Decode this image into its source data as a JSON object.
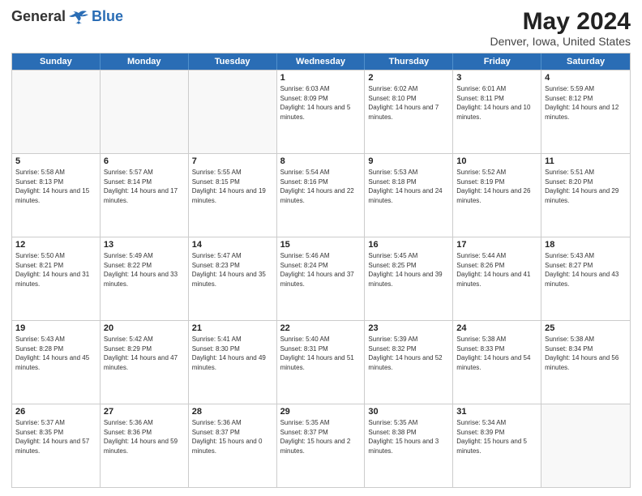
{
  "header": {
    "logo_line1": "General",
    "logo_line2": "Blue",
    "title": "May 2024",
    "subtitle": "Denver, Iowa, United States"
  },
  "weekdays": [
    "Sunday",
    "Monday",
    "Tuesday",
    "Wednesday",
    "Thursday",
    "Friday",
    "Saturday"
  ],
  "weeks": [
    [
      {
        "day": "",
        "empty": true
      },
      {
        "day": "",
        "empty": true
      },
      {
        "day": "",
        "empty": true
      },
      {
        "day": "1",
        "sunrise": "Sunrise: 6:03 AM",
        "sunset": "Sunset: 8:09 PM",
        "daylight": "Daylight: 14 hours and 5 minutes."
      },
      {
        "day": "2",
        "sunrise": "Sunrise: 6:02 AM",
        "sunset": "Sunset: 8:10 PM",
        "daylight": "Daylight: 14 hours and 7 minutes."
      },
      {
        "day": "3",
        "sunrise": "Sunrise: 6:01 AM",
        "sunset": "Sunset: 8:11 PM",
        "daylight": "Daylight: 14 hours and 10 minutes."
      },
      {
        "day": "4",
        "sunrise": "Sunrise: 5:59 AM",
        "sunset": "Sunset: 8:12 PM",
        "daylight": "Daylight: 14 hours and 12 minutes."
      }
    ],
    [
      {
        "day": "5",
        "sunrise": "Sunrise: 5:58 AM",
        "sunset": "Sunset: 8:13 PM",
        "daylight": "Daylight: 14 hours and 15 minutes."
      },
      {
        "day": "6",
        "sunrise": "Sunrise: 5:57 AM",
        "sunset": "Sunset: 8:14 PM",
        "daylight": "Daylight: 14 hours and 17 minutes."
      },
      {
        "day": "7",
        "sunrise": "Sunrise: 5:55 AM",
        "sunset": "Sunset: 8:15 PM",
        "daylight": "Daylight: 14 hours and 19 minutes."
      },
      {
        "day": "8",
        "sunrise": "Sunrise: 5:54 AM",
        "sunset": "Sunset: 8:16 PM",
        "daylight": "Daylight: 14 hours and 22 minutes."
      },
      {
        "day": "9",
        "sunrise": "Sunrise: 5:53 AM",
        "sunset": "Sunset: 8:18 PM",
        "daylight": "Daylight: 14 hours and 24 minutes."
      },
      {
        "day": "10",
        "sunrise": "Sunrise: 5:52 AM",
        "sunset": "Sunset: 8:19 PM",
        "daylight": "Daylight: 14 hours and 26 minutes."
      },
      {
        "day": "11",
        "sunrise": "Sunrise: 5:51 AM",
        "sunset": "Sunset: 8:20 PM",
        "daylight": "Daylight: 14 hours and 29 minutes."
      }
    ],
    [
      {
        "day": "12",
        "sunrise": "Sunrise: 5:50 AM",
        "sunset": "Sunset: 8:21 PM",
        "daylight": "Daylight: 14 hours and 31 minutes."
      },
      {
        "day": "13",
        "sunrise": "Sunrise: 5:49 AM",
        "sunset": "Sunset: 8:22 PM",
        "daylight": "Daylight: 14 hours and 33 minutes."
      },
      {
        "day": "14",
        "sunrise": "Sunrise: 5:47 AM",
        "sunset": "Sunset: 8:23 PM",
        "daylight": "Daylight: 14 hours and 35 minutes."
      },
      {
        "day": "15",
        "sunrise": "Sunrise: 5:46 AM",
        "sunset": "Sunset: 8:24 PM",
        "daylight": "Daylight: 14 hours and 37 minutes."
      },
      {
        "day": "16",
        "sunrise": "Sunrise: 5:45 AM",
        "sunset": "Sunset: 8:25 PM",
        "daylight": "Daylight: 14 hours and 39 minutes."
      },
      {
        "day": "17",
        "sunrise": "Sunrise: 5:44 AM",
        "sunset": "Sunset: 8:26 PM",
        "daylight": "Daylight: 14 hours and 41 minutes."
      },
      {
        "day": "18",
        "sunrise": "Sunrise: 5:43 AM",
        "sunset": "Sunset: 8:27 PM",
        "daylight": "Daylight: 14 hours and 43 minutes."
      }
    ],
    [
      {
        "day": "19",
        "sunrise": "Sunrise: 5:43 AM",
        "sunset": "Sunset: 8:28 PM",
        "daylight": "Daylight: 14 hours and 45 minutes."
      },
      {
        "day": "20",
        "sunrise": "Sunrise: 5:42 AM",
        "sunset": "Sunset: 8:29 PM",
        "daylight": "Daylight: 14 hours and 47 minutes."
      },
      {
        "day": "21",
        "sunrise": "Sunrise: 5:41 AM",
        "sunset": "Sunset: 8:30 PM",
        "daylight": "Daylight: 14 hours and 49 minutes."
      },
      {
        "day": "22",
        "sunrise": "Sunrise: 5:40 AM",
        "sunset": "Sunset: 8:31 PM",
        "daylight": "Daylight: 14 hours and 51 minutes."
      },
      {
        "day": "23",
        "sunrise": "Sunrise: 5:39 AM",
        "sunset": "Sunset: 8:32 PM",
        "daylight": "Daylight: 14 hours and 52 minutes."
      },
      {
        "day": "24",
        "sunrise": "Sunrise: 5:38 AM",
        "sunset": "Sunset: 8:33 PM",
        "daylight": "Daylight: 14 hours and 54 minutes."
      },
      {
        "day": "25",
        "sunrise": "Sunrise: 5:38 AM",
        "sunset": "Sunset: 8:34 PM",
        "daylight": "Daylight: 14 hours and 56 minutes."
      }
    ],
    [
      {
        "day": "26",
        "sunrise": "Sunrise: 5:37 AM",
        "sunset": "Sunset: 8:35 PM",
        "daylight": "Daylight: 14 hours and 57 minutes."
      },
      {
        "day": "27",
        "sunrise": "Sunrise: 5:36 AM",
        "sunset": "Sunset: 8:36 PM",
        "daylight": "Daylight: 14 hours and 59 minutes."
      },
      {
        "day": "28",
        "sunrise": "Sunrise: 5:36 AM",
        "sunset": "Sunset: 8:37 PM",
        "daylight": "Daylight: 15 hours and 0 minutes."
      },
      {
        "day": "29",
        "sunrise": "Sunrise: 5:35 AM",
        "sunset": "Sunset: 8:37 PM",
        "daylight": "Daylight: 15 hours and 2 minutes."
      },
      {
        "day": "30",
        "sunrise": "Sunrise: 5:35 AM",
        "sunset": "Sunset: 8:38 PM",
        "daylight": "Daylight: 15 hours and 3 minutes."
      },
      {
        "day": "31",
        "sunrise": "Sunrise: 5:34 AM",
        "sunset": "Sunset: 8:39 PM",
        "daylight": "Daylight: 15 hours and 5 minutes."
      },
      {
        "day": "",
        "empty": true
      }
    ]
  ]
}
